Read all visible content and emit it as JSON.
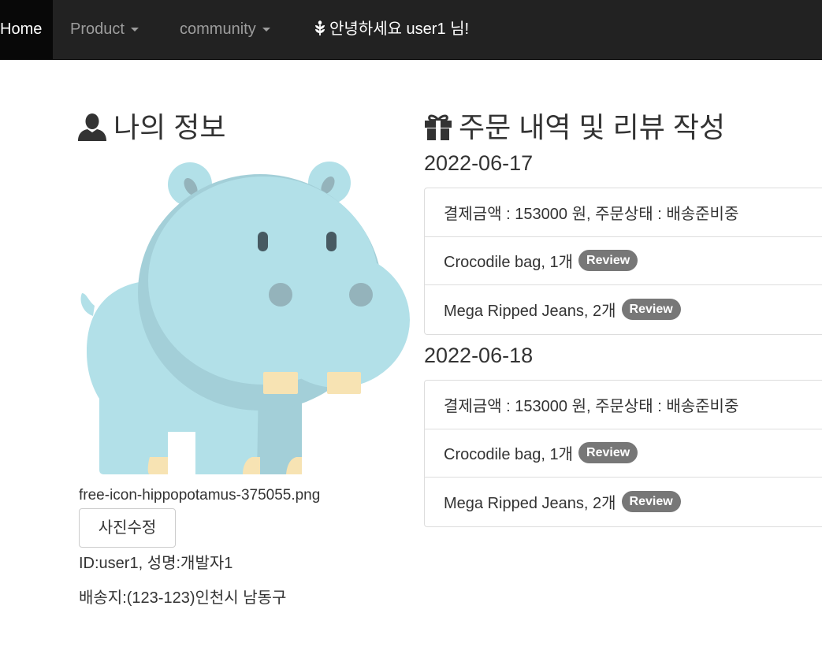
{
  "nav": {
    "home": "Home",
    "product": "Product",
    "community": "community",
    "greeting": "안녕하세요 user1 님!"
  },
  "profile": {
    "heading": "나의 정보",
    "filename": "free-icon-hippopotamus-375055.png",
    "edit_photo": "사진수정",
    "id_line": "ID:user1, 성명:개발자1",
    "address": "배송지:(123-123)인천시 남동구"
  },
  "orders": {
    "heading": "주문 내역 및 리뷰 작성",
    "groups": [
      {
        "date": "2022-06-17",
        "summary": "결제금액 : 153000 원, 주문상태 : 배송준비중",
        "items": [
          {
            "label": "Crocodile bag, 1개",
            "badge": "Review"
          },
          {
            "label": "Mega Ripped Jeans, 2개",
            "badge": "Review"
          }
        ]
      },
      {
        "date": "2022-06-18",
        "summary": "결제금액 : 153000 원, 주문상태 : 배송준비중",
        "items": [
          {
            "label": "Crocodile bag, 1개",
            "badge": "Review"
          },
          {
            "label": "Mega Ripped Jeans, 2개",
            "badge": "Review"
          }
        ]
      }
    ]
  },
  "colors": {
    "navbar": "#222222",
    "nav_active": "#080808",
    "hippo_body": "#b2e0e8",
    "hippo_shade": "#a3cfd8",
    "hippo_teeth": "#f7e3b3",
    "badge": "#777777"
  },
  "icons": {
    "greeting": "leaf-icon",
    "profile": "user-icon",
    "orders": "gift-icon"
  }
}
